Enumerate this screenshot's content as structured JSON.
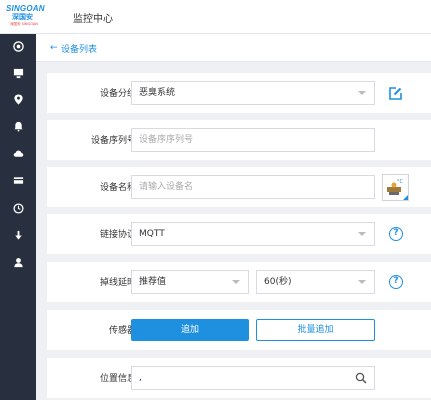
{
  "header": {
    "logo_text": "SINGOAN",
    "logo_cn": "深国安",
    "logo_sub": "深国安 SINGOAN",
    "title": "监控中心"
  },
  "sidebar": {
    "items": [
      {
        "icon": "target-icon"
      },
      {
        "icon": "monitor-icon"
      },
      {
        "icon": "location-pin-icon"
      },
      {
        "icon": "bell-icon"
      },
      {
        "icon": "cloud-icon"
      },
      {
        "icon": "card-icon"
      },
      {
        "icon": "clock-icon"
      },
      {
        "icon": "download-icon"
      },
      {
        "icon": "user-icon"
      }
    ]
  },
  "breadcrumb": {
    "back_icon": "←",
    "label": "设备列表"
  },
  "form": {
    "group": {
      "label": "设备分组",
      "value": "恶臭系统"
    },
    "serial": {
      "label": "设备序列号",
      "placeholder": "设备序序列号"
    },
    "name": {
      "label": "设备名称",
      "placeholder": "请输入设备名"
    },
    "protocol": {
      "label": "链接协议",
      "value": "MQTT",
      "help": "?"
    },
    "delay": {
      "label": "掉线延时",
      "mode": "推荐值",
      "value": "60(秒)",
      "help": "?"
    },
    "sensor": {
      "label": "传感器",
      "add_label": "追加",
      "batch_label": "批量追加"
    },
    "location": {
      "label": "位置信息",
      "value": ","
    }
  },
  "colors": {
    "accent": "#1f8fe0",
    "sidebar_bg": "#283040",
    "page_bg": "#eef0f4"
  }
}
